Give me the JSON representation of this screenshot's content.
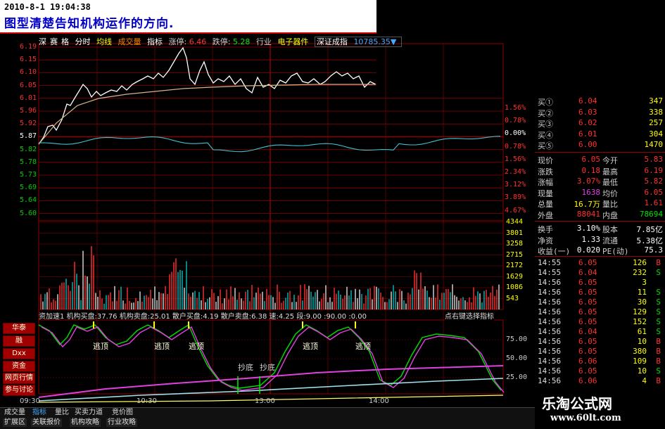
{
  "caption": {
    "datetime": "2010-8-1 19:04:38",
    "text": "图型清楚告知机构运作的方向."
  },
  "header": {
    "items": [
      "深",
      "赛",
      "格",
      "分时",
      "均线",
      "成交量",
      "指标",
      "涨停:",
      "6.46",
      "跌停:",
      "5.28",
      "行业",
      "电子器件",
      "深证成指",
      "10785.35▼"
    ]
  },
  "price_axis_left": [
    "6.19",
    "6.15",
    "6.10",
    "6.05",
    "6.01",
    "5.96",
    "5.92",
    "5.87",
    "5.82",
    "5.78",
    "5.73",
    "5.69",
    "5.64",
    "5.60"
  ],
  "price_axis_right": [
    "1.56%",
    "0.78%",
    "0.00%",
    "0.78%",
    "1.56%",
    "2.34%",
    "3.12%",
    "3.89%",
    "4.67%"
  ],
  "volume_axis": [
    "4344",
    "3801",
    "3258",
    "2715",
    "2172",
    "1629",
    "1086",
    "543"
  ],
  "indicator_header": "资加速1  机构买盘:37.76  机构卖盘:25.01  散户买盘:4.19  散户卖盘:6.38  速:4.25  段:9.00  :90.00  :0.00",
  "indicator_hint": "点右键选择指标",
  "indicator_axis": [
    "75.00",
    "50.00",
    "25.00"
  ],
  "indicator_labels": {
    "top1": "逃顶",
    "top2": "逃顶",
    "top3": "逃顶",
    "top4": "逃顶",
    "top5": "逃顶",
    "bottom1": "抄底",
    "bottom2": "抄底"
  },
  "time_axis": [
    "09:30",
    "10:30",
    "13:00",
    "14:00"
  ],
  "side_buttons": [
    "华泰",
    "融",
    "Dxx",
    "资金",
    "网页行情",
    "参与讨论"
  ],
  "bottom_tabs_row1": [
    "成交量",
    "指标",
    "量比",
    "买卖力道",
    "竞价图"
  ],
  "bottom_tabs_row2": [
    "扩展区",
    "关联报价",
    "机构攻略",
    "行业攻略"
  ],
  "order_book": [
    {
      "label": "买①",
      "price": "6.04",
      "vol": "347"
    },
    {
      "label": "买②",
      "price": "6.03",
      "vol": "338"
    },
    {
      "label": "买③",
      "price": "6.02",
      "vol": "257"
    },
    {
      "label": "买④",
      "price": "6.01",
      "vol": "304"
    },
    {
      "label": "买⑤",
      "price": "6.00",
      "vol": "1470"
    }
  ],
  "quote": [
    {
      "k1": "现价",
      "v1": "6.05",
      "k2": "今开",
      "v2": "5.83"
    },
    {
      "k1": "涨跌",
      "v1": "0.18",
      "k2": "最高",
      "v2": "6.19"
    },
    {
      "k1": "涨幅",
      "v1": "3.07%",
      "k2": "最低",
      "v2": "5.82"
    },
    {
      "k1": "现量",
      "v1": "1638",
      "k2": "均价",
      "v2": "6.05"
    },
    {
      "k1": "总量",
      "v1": "16.7万",
      "k2": "量比",
      "v2": "1.61"
    },
    {
      "k1": "外盘",
      "v1": "88041",
      "k2": "内盘",
      "v2": "78694"
    }
  ],
  "stats": [
    {
      "k1": "换手",
      "v1": "3.10%",
      "k2": "股本",
      "v2": "7.85亿"
    },
    {
      "k1": "净资",
      "v1": "1.33",
      "k2": "流通",
      "v2": "5.38亿"
    },
    {
      "k1": "收益(一)",
      "v1": "0.020",
      "k2": "PE(动)",
      "v2": "75.3"
    }
  ],
  "ticks": [
    {
      "t": "14:55",
      "p": "6.05",
      "v": "126",
      "s": "B"
    },
    {
      "t": "14:55",
      "p": "6.04",
      "v": "232",
      "s": "S"
    },
    {
      "t": "14:56",
      "p": "6.05",
      "v": "3",
      "s": ""
    },
    {
      "t": "14:56",
      "p": "6.05",
      "v": "11",
      "s": "S"
    },
    {
      "t": "14:56",
      "p": "6.05",
      "v": "30",
      "s": "S"
    },
    {
      "t": "14:56",
      "p": "6.05",
      "v": "129",
      "s": "S"
    },
    {
      "t": "14:56",
      "p": "6.05",
      "v": "152",
      "s": "S"
    },
    {
      "t": "14:56",
      "p": "6.04",
      "v": "61",
      "s": "S"
    },
    {
      "t": "14:56",
      "p": "6.05",
      "v": "10",
      "s": "B"
    },
    {
      "t": "14:56",
      "p": "6.05",
      "v": "380",
      "s": "B"
    },
    {
      "t": "14:56",
      "p": "6.06",
      "v": "109",
      "s": "B"
    },
    {
      "t": "14:56",
      "p": "6.05",
      "v": "10",
      "s": "S"
    },
    {
      "t": "14:56",
      "p": "6.06",
      "v": "4",
      "s": "B"
    }
  ],
  "watermark": {
    "title": "乐淘公式网",
    "url": "www.60lt.com"
  },
  "colors": {
    "up": "#ff3030",
    "down": "#00e000",
    "grid": "#8b0000",
    "price_line": "#ffffff",
    "avg_line": "#d2b48c",
    "cyan": "#40c0d0",
    "magenta": "#e040e0",
    "yellow": "#ffff00"
  }
}
